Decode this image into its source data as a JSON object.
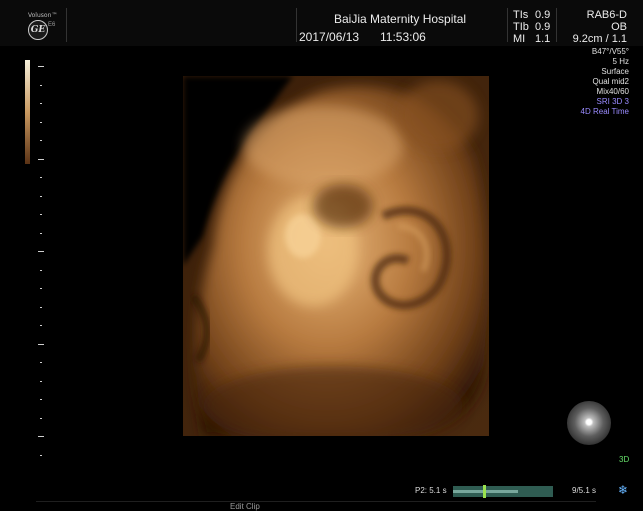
{
  "header": {
    "logo_text": "Voluson™",
    "brand_mark": "GE",
    "brand_sub": "E6",
    "hospital": "BaiJia Maternity Hospital",
    "date": "2017/06/13",
    "time": "11:53:06",
    "ti": [
      {
        "label": "TIs",
        "value": "0.9"
      },
      {
        "label": "TIb",
        "value": "0.9"
      },
      {
        "label": "MI",
        "value": "1.1"
      }
    ],
    "probe": "RAB6-D",
    "preset": "OB",
    "depth_freq": "9.2cm / 1.1"
  },
  "params": {
    "angle": "B47°/V55°",
    "rate": "5 Hz",
    "render_mode": "Surface",
    "quality": "Qual mid2",
    "mix": "Mix40/60",
    "sri": "SRI 3D 3",
    "mode": "4D Real Time"
  },
  "colors": {
    "accent_blue": "#9a8bff",
    "status_green": "#66e06a",
    "cine_bar": "#2f5c52"
  },
  "orientation_tag": "3D",
  "footer": {
    "p2": "P2: 5.1 s",
    "buffer_fraction": 0.65,
    "marker_fraction": 0.3,
    "frames": "9/5.1 s",
    "edit_clip": "Edit Clip",
    "snow_icon": "❄"
  }
}
